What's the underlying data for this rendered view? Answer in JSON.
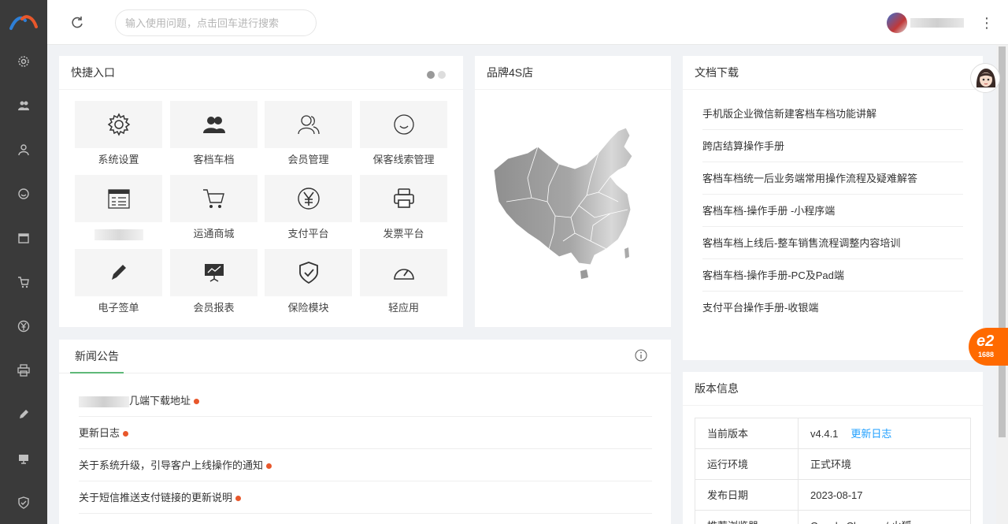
{
  "header": {
    "search_placeholder": "输入使用问题，点击回车进行搜索"
  },
  "sidebar": {
    "items": [
      {
        "icon": "gear-icon"
      },
      {
        "icon": "users-icon"
      },
      {
        "icon": "user-icon"
      },
      {
        "icon": "smile-icon"
      },
      {
        "icon": "calendar-icon"
      },
      {
        "icon": "cart-icon"
      },
      {
        "icon": "yen-icon"
      },
      {
        "icon": "printer-icon"
      },
      {
        "icon": "pen-icon"
      },
      {
        "icon": "presentation-icon"
      },
      {
        "icon": "shield-icon"
      }
    ]
  },
  "quick_entry": {
    "title": "快捷入口",
    "items": [
      {
        "label": "系统设置",
        "icon": "gear-icon"
      },
      {
        "label": "客档车档",
        "icon": "users-icon"
      },
      {
        "label": "会员管理",
        "icon": "user-outline-icon"
      },
      {
        "label": "保客线索管理",
        "icon": "smile-icon"
      },
      {
        "label": "",
        "icon": "calendar-icon"
      },
      {
        "label": "运通商城",
        "icon": "cart-icon"
      },
      {
        "label": "支付平台",
        "icon": "yen-icon"
      },
      {
        "label": "发票平台",
        "icon": "printer-icon"
      },
      {
        "label": "电子签单",
        "icon": "pen-icon"
      },
      {
        "label": "会员报表",
        "icon": "presentation-icon"
      },
      {
        "label": "保险模块",
        "icon": "shield-icon"
      },
      {
        "label": "轻应用",
        "icon": "gauge-icon"
      }
    ]
  },
  "brand_map": {
    "title": "品牌4S店"
  },
  "docs": {
    "title": "文档下载",
    "items": [
      "手机版企业微信新建客档车档功能讲解",
      "跨店结算操作手册",
      "客档车档统一后业务端常用操作流程及疑难解答",
      "客档车档-操作手册 -小程序端",
      "客档车档上线后-整车销售流程调整内容培训",
      "客档车档-操作手册-PC及Pad端",
      "支付平台操作手册-收银端"
    ]
  },
  "news": {
    "tab": "新闻公告",
    "items": [
      {
        "text": "几端下载地址",
        "blurred_prefix": true
      },
      {
        "text": "更新日志",
        "blurred_prefix": false
      },
      {
        "text": "关于系统升级，引导客户上线操作的通知",
        "blurred_prefix": false
      },
      {
        "text": "关于短信推送支付链接的更新说明",
        "blurred_prefix": false
      }
    ]
  },
  "version": {
    "title": "版本信息",
    "rows": [
      {
        "key": "当前版本",
        "value": "v4.4.1",
        "link": "更新日志"
      },
      {
        "key": "运行环境",
        "value": "正式环境",
        "link": ""
      },
      {
        "key": "发布日期",
        "value": "2023-08-17",
        "link": ""
      },
      {
        "key": "推荐浏览器",
        "value": "Google Chrome / 火狐",
        "link": ""
      }
    ]
  },
  "floating": {
    "badge_text": "1688"
  },
  "colors": {
    "sidebar_bg": "#3a3a3a",
    "accent_green": "#5fb878",
    "link_blue": "#1e9fff",
    "dot_red": "#e8572b",
    "orange": "#ff6a00"
  }
}
